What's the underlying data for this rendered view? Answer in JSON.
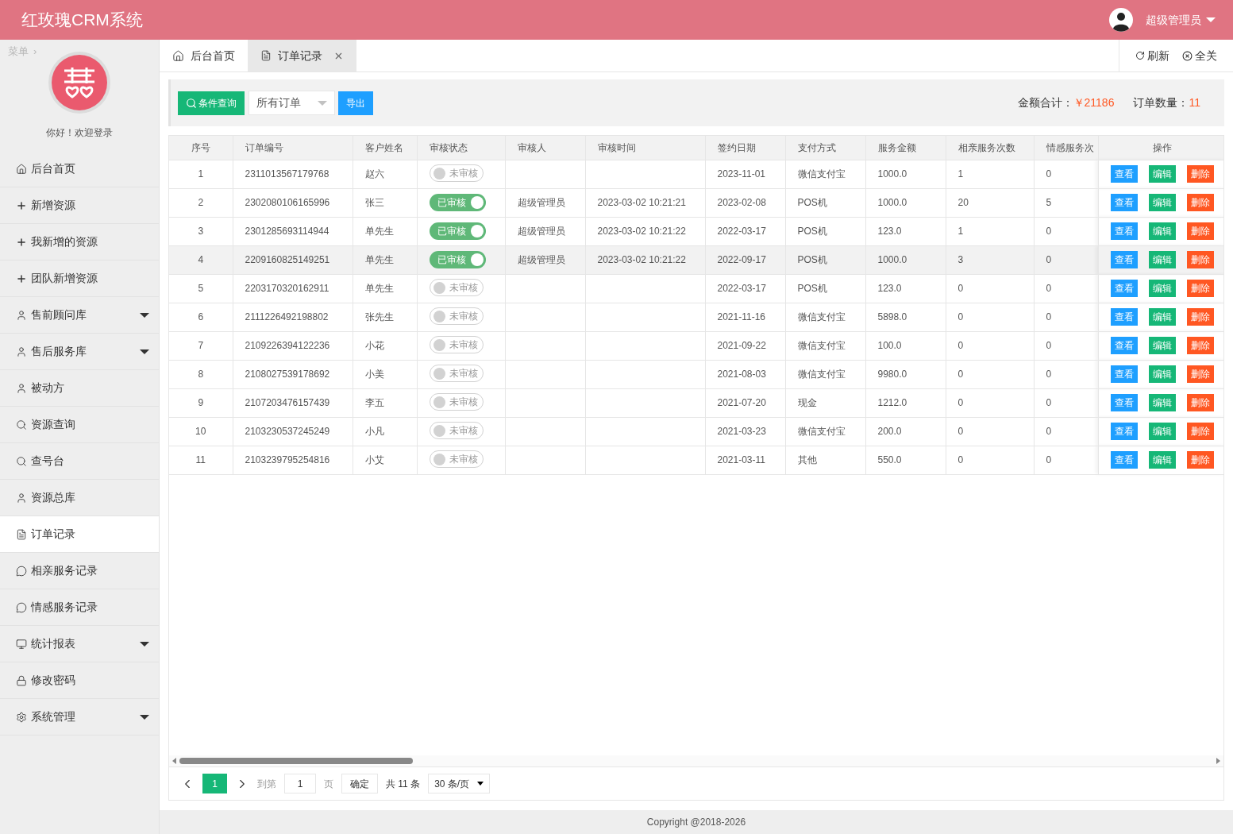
{
  "header": {
    "title": "红玫瑰CRM系统",
    "user": "超级管理员"
  },
  "sidebar": {
    "menu_label": "菜单",
    "menu_arrow": "›",
    "greeting": "你好！欢迎登录",
    "items": [
      {
        "label": "后台首页",
        "selected": false,
        "has_submenu": false
      },
      {
        "label": "新增资源",
        "selected": false,
        "has_submenu": false
      },
      {
        "label": "我新增的资源",
        "selected": false,
        "has_submenu": false
      },
      {
        "label": "团队新增资源",
        "selected": false,
        "has_submenu": false
      },
      {
        "label": "售前顾问库",
        "selected": false,
        "has_submenu": true
      },
      {
        "label": "售后服务库",
        "selected": false,
        "has_submenu": true
      },
      {
        "label": "被动方",
        "selected": false,
        "has_submenu": false
      },
      {
        "label": "资源查询",
        "selected": false,
        "has_submenu": false
      },
      {
        "label": "查号台",
        "selected": false,
        "has_submenu": false
      },
      {
        "label": "资源总库",
        "selected": false,
        "has_submenu": false
      },
      {
        "label": "订单记录",
        "selected": true,
        "has_submenu": false
      },
      {
        "label": "相亲服务记录",
        "selected": false,
        "has_submenu": false
      },
      {
        "label": "情感服务记录",
        "selected": false,
        "has_submenu": false
      },
      {
        "label": "统计报表",
        "selected": false,
        "has_submenu": true
      },
      {
        "label": "修改密码",
        "selected": false,
        "has_submenu": false
      },
      {
        "label": "系统管理",
        "selected": false,
        "has_submenu": true
      }
    ]
  },
  "tabs": [
    {
      "label": "后台首页",
      "selected": false,
      "closable": false
    },
    {
      "label": "订单记录",
      "selected": true,
      "closable": true
    }
  ],
  "tab_actions": [
    "刷新",
    "全关"
  ],
  "toolbar": {
    "search_button": "条件查询",
    "filter": "所有订单",
    "export_button": "导出",
    "total_label": "金额合计：",
    "total_value": "￥21186",
    "count_label": "订单数量：",
    "count_value": "11"
  },
  "table": {
    "columns": [
      "序号",
      "订单编号",
      "客户姓名",
      "审核状态",
      "审核人",
      "审核时间",
      "签约日期",
      "支付方式",
      "服务金额",
      "相亲服务次数",
      "情感服务次",
      "操作"
    ],
    "rows": [
      {
        "cells": [
          "1",
          "2311013567179768",
          "赵六",
          "未审核",
          "",
          "",
          "2023-11-01",
          "微信支付宝",
          "1000.0",
          "1",
          "0"
        ],
        "actions": [
          "查看",
          "编辑",
          "删除"
        ],
        "approved": false,
        "selected": false
      },
      {
        "cells": [
          "2",
          "2302080106165996",
          "张三",
          "已审核",
          "超级管理员",
          "2023-03-02 10:21:21",
          "2023-02-08",
          "POS机",
          "1000.0",
          "20",
          "5"
        ],
        "actions": [
          "查看",
          "编辑",
          "删除"
        ],
        "approved": true,
        "selected": false
      },
      {
        "cells": [
          "3",
          "2301285693114944",
          "单先生",
          "已审核",
          "超级管理员",
          "2023-03-02 10:21:22",
          "2022-03-17",
          "POS机",
          "123.0",
          "1",
          "0"
        ],
        "actions": [
          "查看",
          "编辑",
          "删除"
        ],
        "approved": true,
        "selected": false
      },
      {
        "cells": [
          "4",
          "2209160825149251",
          "单先生",
          "已审核",
          "超级管理员",
          "2023-03-02 10:21:22",
          "2022-09-17",
          "POS机",
          "1000.0",
          "3",
          "0"
        ],
        "actions": [
          "查看",
          "编辑",
          "删除"
        ],
        "approved": true,
        "selected": true
      },
      {
        "cells": [
          "5",
          "2203170320162911",
          "单先生",
          "未审核",
          "",
          "",
          "2022-03-17",
          "POS机",
          "123.0",
          "0",
          "0"
        ],
        "actions": [
          "查看",
          "编辑",
          "删除"
        ],
        "approved": false,
        "selected": false
      },
      {
        "cells": [
          "6",
          "2111226492198802",
          "张先生",
          "未审核",
          "",
          "",
          "2021-11-16",
          "微信支付宝",
          "5898.0",
          "0",
          "0"
        ],
        "actions": [
          "查看",
          "编辑",
          "删除"
        ],
        "approved": false,
        "selected": false
      },
      {
        "cells": [
          "7",
          "2109226394122236",
          "小花",
          "未审核",
          "",
          "",
          "2021-09-22",
          "微信支付宝",
          "100.0",
          "0",
          "0"
        ],
        "actions": [
          "查看",
          "编辑",
          "删除"
        ],
        "approved": false,
        "selected": false
      },
      {
        "cells": [
          "8",
          "2108027539178692",
          "小美",
          "未审核",
          "",
          "",
          "2021-08-03",
          "微信支付宝",
          "9980.0",
          "0",
          "0"
        ],
        "actions": [
          "查看",
          "编辑",
          "删除"
        ],
        "approved": false,
        "selected": false
      },
      {
        "cells": [
          "9",
          "2107203476157439",
          "李五",
          "未审核",
          "",
          "",
          "2021-07-20",
          "现金",
          "1212.0",
          "0",
          "0"
        ],
        "actions": [
          "查看",
          "编辑",
          "删除"
        ],
        "approved": false,
        "selected": false
      },
      {
        "cells": [
          "10",
          "2103230537245249",
          "小凡",
          "未审核",
          "",
          "",
          "2021-03-23",
          "微信支付宝",
          "200.0",
          "0",
          "0"
        ],
        "actions": [
          "查看",
          "编辑",
          "删除"
        ],
        "approved": false,
        "selected": false
      },
      {
        "cells": [
          "11",
          "2103239795254816",
          "小艾",
          "未审核",
          "",
          "",
          "2021-03-11",
          "其他",
          "550.0",
          "0",
          "0"
        ],
        "actions": [
          "查看",
          "编辑",
          "删除"
        ],
        "approved": false,
        "selected": false
      }
    ]
  },
  "pagination": {
    "current": "1",
    "goto_label": "到第",
    "goto_value": "1",
    "page_label": "页",
    "confirm": "确定",
    "total": "共 11 条",
    "page_size": "30 条/页"
  },
  "footer": "Copyright @2018-2026"
}
